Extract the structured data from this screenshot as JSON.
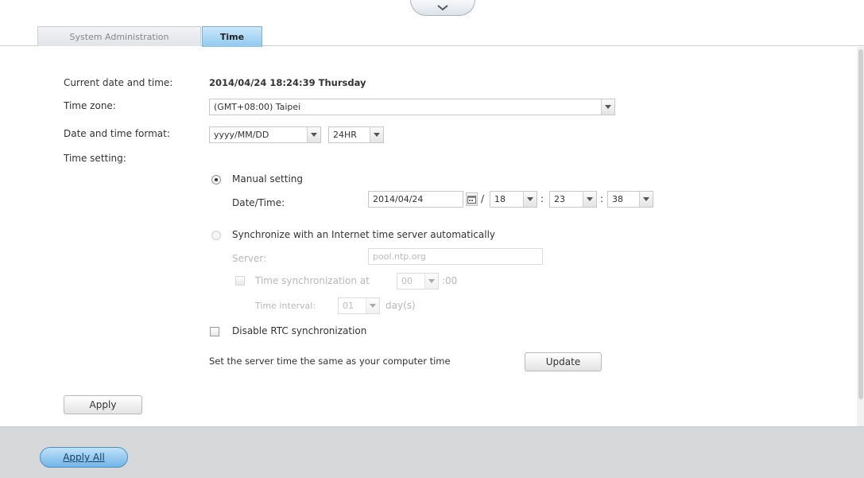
{
  "tabs": [
    {
      "label": "System Administration",
      "active": false
    },
    {
      "label": "Time",
      "active": true
    }
  ],
  "form": {
    "current_label": "Current date and time:",
    "current_value": "2014/04/24 18:24:39 Thursday",
    "timezone_label": "Time zone:",
    "timezone_value": "(GMT+08:00) Taipei",
    "format_label": "Date and time format:",
    "date_format_value": "yyyy/MM/DD",
    "hour_format_value": "24HR",
    "time_setting_label": "Time setting:"
  },
  "manual": {
    "label": "Manual setting",
    "selected": true,
    "datetime_label": "Date/Time:",
    "date_value": "2014/04/24",
    "sep_slash": "/",
    "sep_colon": ":",
    "hour_value": "18",
    "minute_value": "23",
    "second_value": "38"
  },
  "sync": {
    "label": "Synchronize with an Internet time server automatically",
    "selected": false,
    "server_label": "Server:",
    "server_value": "pool.ntp.org",
    "sync_at_label": "Time synchronization at",
    "sync_at_value": "00",
    "sync_at_suffix": ":00",
    "interval_label": "Time interval:",
    "interval_value": "01",
    "interval_unit": "day(s)"
  },
  "rtc": {
    "label": "Disable RTC synchronization",
    "checked": false
  },
  "computer_time": {
    "label": "Set the server time the same as your computer time",
    "button": "Update"
  },
  "buttons": {
    "apply": "Apply",
    "apply_all": "Apply All"
  },
  "icons": {
    "collapse": "chevron-down-icon",
    "dropdown": "dropdown-arrow-icon",
    "calendar": "calendar-icon"
  },
  "colors": {
    "active_tab": "#8fc8ef",
    "footer": "#d6d8da",
    "apply_all": "#72b5e6"
  }
}
